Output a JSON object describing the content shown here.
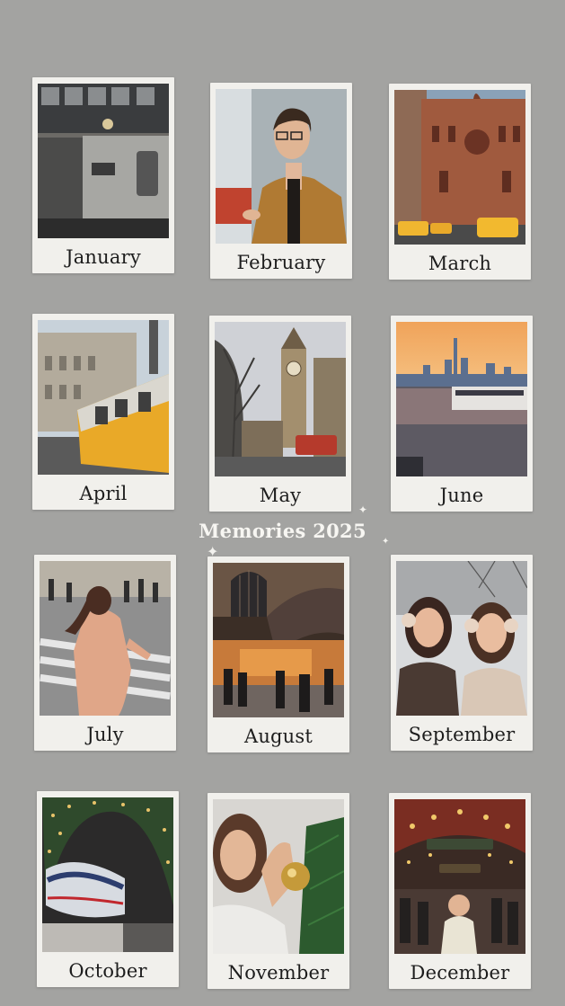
{
  "title": "Memories 2025",
  "months": [
    {
      "label": "January",
      "photo": "subway-train-photo"
    },
    {
      "label": "February",
      "photo": "man-in-camel-coat-photo"
    },
    {
      "label": "March",
      "photo": "new-york-street-taxis-photo"
    },
    {
      "label": "April",
      "photo": "yellow-tram-photo"
    },
    {
      "label": "May",
      "photo": "big-ben-london-photo"
    },
    {
      "label": "June",
      "photo": "sunset-skyline-waterfront-photo"
    },
    {
      "label": "July",
      "photo": "woman-crossing-street-photo"
    },
    {
      "label": "August",
      "photo": "train-station-hall-photo"
    },
    {
      "label": "September",
      "photo": "two-friends-earmuffs-photo"
    },
    {
      "label": "October",
      "photo": "christmas-train-arch-photo"
    },
    {
      "label": "November",
      "photo": "woman-holding-ornament-photo"
    },
    {
      "label": "December",
      "photo": "christmas-market-photo"
    }
  ],
  "colors": {
    "background": "#a3a3a1",
    "card": "#f1f0ec",
    "title_text": "#f7f6f2"
  }
}
